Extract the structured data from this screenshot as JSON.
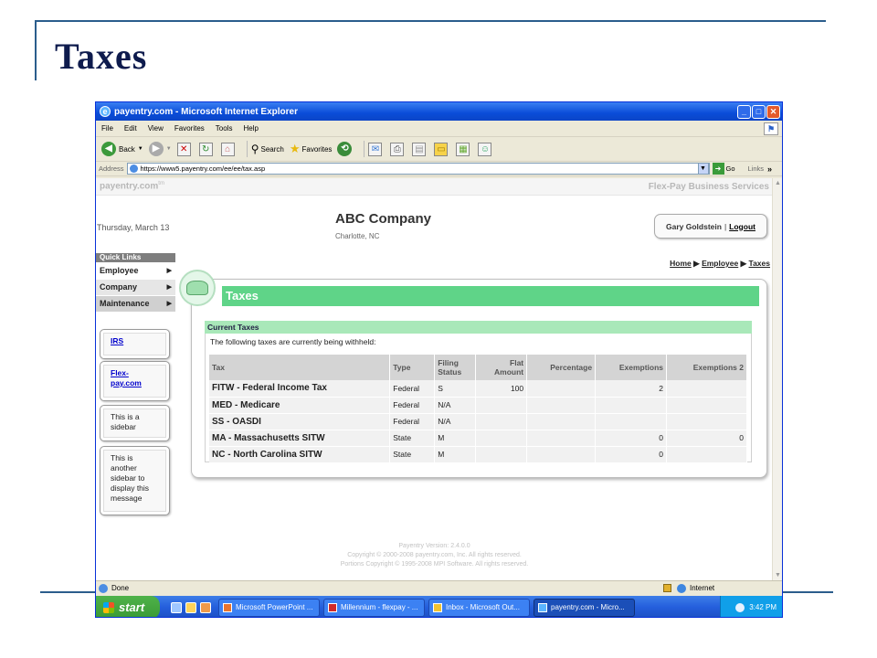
{
  "slide": {
    "title": "Taxes"
  },
  "window": {
    "title": "payentry.com - Microsoft Internet Explorer",
    "buttons": {
      "minimize": "_",
      "maximize": "□",
      "close": "✕"
    }
  },
  "menu": [
    "File",
    "Edit",
    "View",
    "Favorites",
    "Tools",
    "Help"
  ],
  "toolbar": {
    "back": "Back",
    "search": "Search",
    "favorites": "Favorites"
  },
  "address": {
    "label": "Address",
    "url": "https://www5.payentry.com/ee/ee/tax.asp",
    "go": "Go",
    "links": "Links"
  },
  "site": {
    "logo": "payentry.com",
    "logo_tm": "tm",
    "services": "Flex-Pay Business Services",
    "date": "Thursday, March 13",
    "company": "ABC Company",
    "location": "Charlotte, NC",
    "user": "Gary Goldstein",
    "user_sep": "|",
    "logout": "Logout"
  },
  "quick_links": {
    "heading": "Quick Links",
    "items": [
      "Employee",
      "Company",
      "Maintenance"
    ]
  },
  "sidebar": {
    "irs": "IRS",
    "flexpay": "Flex-pay.com",
    "note1": "This is a sidebar",
    "note2": "This is another sidebar to display this message"
  },
  "breadcrumb": {
    "home": "Home",
    "employee": "Employee",
    "taxes": "Taxes",
    "sep": "▶"
  },
  "panel": {
    "title": "Taxes",
    "section": "Current Taxes",
    "description": "The following taxes are currently being withheld:"
  },
  "table": {
    "headers": {
      "tax": "Tax",
      "type": "Type",
      "filing": "Filing Status",
      "flat": "Flat Amount",
      "percentage": "Percentage",
      "exemptions": "Exemptions",
      "exemptions2": "Exemptions 2"
    },
    "rows": [
      {
        "tax": "FITW - Federal Income Tax",
        "type": "Federal",
        "filing": "S",
        "flat": "100",
        "percentage": "",
        "exemptions": "2",
        "exemptions2": ""
      },
      {
        "tax": "MED - Medicare",
        "type": "Federal",
        "filing": "N/A",
        "flat": "",
        "percentage": "",
        "exemptions": "",
        "exemptions2": ""
      },
      {
        "tax": "SS - OASDI",
        "type": "Federal",
        "filing": "N/A",
        "flat": "",
        "percentage": "",
        "exemptions": "",
        "exemptions2": ""
      },
      {
        "tax": "MA - Massachusetts SITW",
        "type": "State",
        "filing": "M",
        "flat": "",
        "percentage": "",
        "exemptions": "0",
        "exemptions2": "0"
      },
      {
        "tax": "NC - North Carolina SITW",
        "type": "State",
        "filing": "M",
        "flat": "",
        "percentage": "",
        "exemptions": "0",
        "exemptions2": ""
      }
    ]
  },
  "footer": {
    "line1": "Payentry Version: 2.4.0.0",
    "line2": "Copyright © 2000-2008 payentry.com, Inc. All rights reserved.",
    "line3": "Portions Copyright © 1995-2008 MPI Software. All rights reserved."
  },
  "status": {
    "text": "Done",
    "zone": "Internet"
  },
  "taskbar": {
    "start": "start",
    "tasks": [
      "Microsoft PowerPoint ...",
      "Millennium - flexpay - ...",
      "Inbox - Microsoft Out...",
      "payentry.com - Micro..."
    ],
    "time": "3:42 PM"
  }
}
